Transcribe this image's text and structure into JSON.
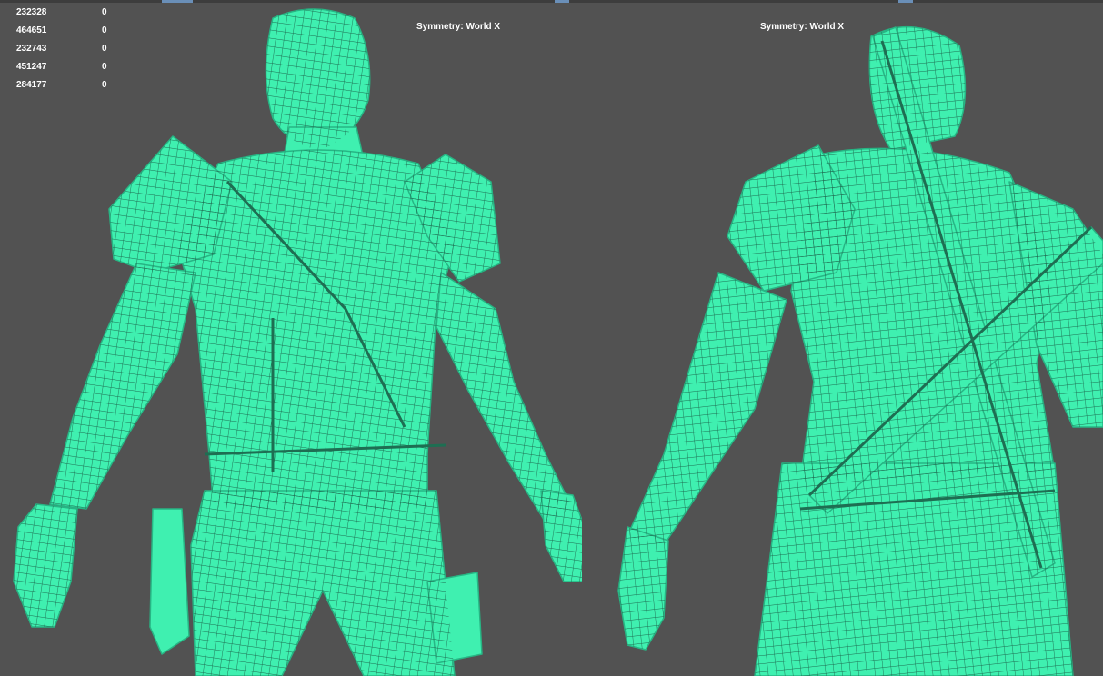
{
  "hud": {
    "rows": [
      {
        "id": "232328",
        "value": "0"
      },
      {
        "id": "464651",
        "value": "0"
      },
      {
        "id": "232743",
        "value": "0"
      },
      {
        "id": "451247",
        "value": "0"
      },
      {
        "id": "284177",
        "value": "0"
      }
    ]
  },
  "viewports": {
    "front": {
      "symmetry_label": "Symmetry: World X"
    },
    "back": {
      "symmetry_label": "Symmetry: World X"
    }
  },
  "colors": {
    "background": "#525252",
    "wireframe": "#3ff0b0",
    "wire_lines": "#1e6e52",
    "hud_text": "#ffffff"
  }
}
